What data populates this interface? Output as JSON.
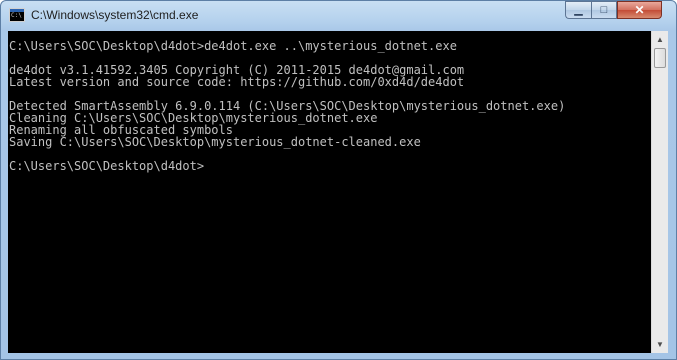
{
  "window": {
    "title": "C:\\Windows\\system32\\cmd.exe",
    "icon_name": "cmd-icon",
    "icon_text": "C:\\"
  },
  "controls": {
    "minimize": "▁",
    "maximize": "□",
    "close": "✕"
  },
  "console": {
    "lines": [
      "C:\\Users\\SOC\\Desktop\\d4dot>de4dot.exe ..\\mysterious_dotnet.exe",
      "",
      "de4dot v3.1.41592.3405 Copyright (C) 2011-2015 de4dot@gmail.com",
      "Latest version and source code: https://github.com/0xd4d/de4dot",
      "",
      "Detected SmartAssembly 6.9.0.114 (C:\\Users\\SOC\\Desktop\\mysterious_dotnet.exe)",
      "Cleaning C:\\Users\\SOC\\Desktop\\mysterious_dotnet.exe",
      "Renaming all obfuscated symbols",
      "Saving C:\\Users\\SOC\\Desktop\\mysterious_dotnet-cleaned.exe",
      "",
      "C:\\Users\\SOC\\Desktop\\d4dot>"
    ],
    "text_color": "#c0c0c0",
    "background": "#000000"
  },
  "scrollbar": {
    "up_icon": "▲",
    "down_icon": "▼"
  }
}
